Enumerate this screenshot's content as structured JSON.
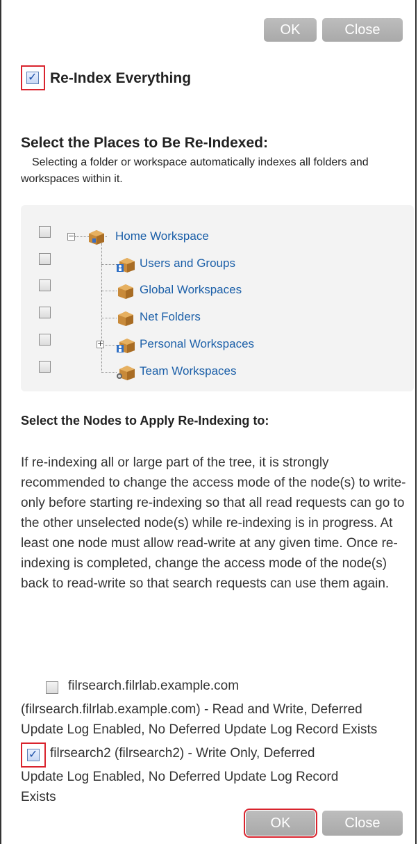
{
  "buttons": {
    "ok": "OK",
    "close": "Close"
  },
  "reindex_everything": {
    "label": "Re-Index Everything",
    "checked": true
  },
  "places": {
    "heading": "Select the Places to Be Re-Indexed:",
    "description": "Selecting a folder or workspace automatically indexes all folders and workspaces within it."
  },
  "tree": {
    "root": {
      "label": "Home Workspace",
      "expander": "−"
    },
    "children": [
      {
        "label": "Users and Groups",
        "icon": "users-folder-icon"
      },
      {
        "label": "Global Workspaces",
        "icon": "workspace-folder-icon"
      },
      {
        "label": "Net Folders",
        "icon": "net-folder-icon"
      },
      {
        "label": "Personal Workspaces",
        "icon": "personal-folder-icon",
        "expander": "+"
      },
      {
        "label": "Team Workspaces",
        "icon": "team-folder-icon"
      }
    ]
  },
  "nodes": {
    "heading": "Select the Nodes to Apply Re-Indexing to:",
    "warning": "If re-indexing all or large part of the tree, it is strongly recommended to change the access mode of the node(s) to write-only before starting re-indexing so that all read requests can go to the other unselected node(s) while re-indexing is in progress. At least one node must allow read-write at any given time. Once re-indexing is completed, change the access mode of the node(s) back to read-write so that search requests can use them again.",
    "items": [
      {
        "line1": "filrsearch.filrlab.example.com",
        "rest": "(filrsearch.filrlab.example.com) - Read and Write, Deferred Update Log Enabled, No Deferred Update Log Record Exists",
        "checked": false
      },
      {
        "line1": "filrsearch2 (filrsearch2) - Write Only, Deferred",
        "rest": "Update Log Enabled, No Deferred Update Log Record Exists",
        "checked": true
      }
    ]
  },
  "colors": {
    "link": "#1b5fa8",
    "highlight": "#d9232d",
    "button": "#aaaaaa"
  }
}
